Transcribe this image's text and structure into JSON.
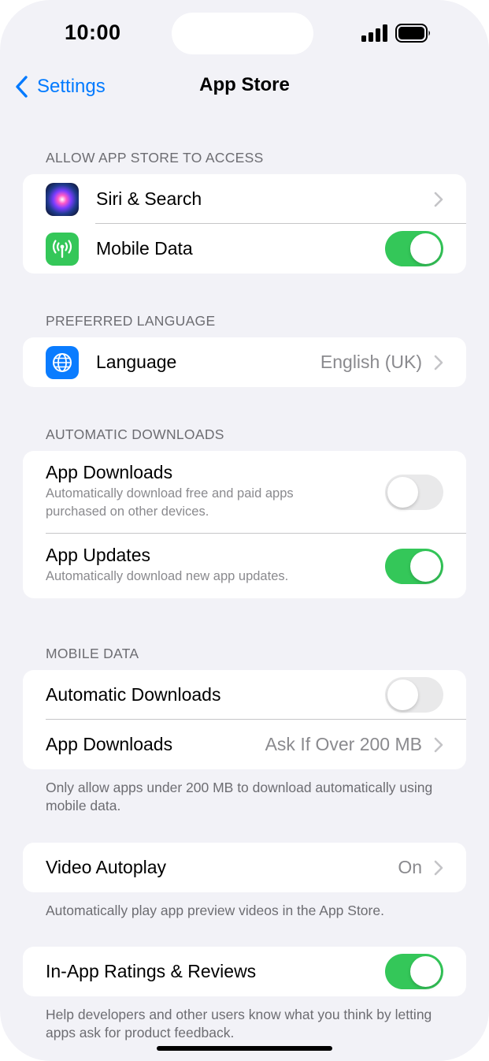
{
  "status_bar": {
    "time": "10:00"
  },
  "nav": {
    "back_label": "Settings",
    "title": "App Store"
  },
  "sections": {
    "access": {
      "header": "ALLOW APP STORE TO ACCESS",
      "siri": {
        "label": "Siri & Search",
        "icon": "siri-icon"
      },
      "mobile_data": {
        "label": "Mobile Data",
        "icon": "antenna-icon",
        "enabled": true
      }
    },
    "language": {
      "header": "PREFERRED LANGUAGE",
      "row": {
        "label": "Language",
        "value": "English (UK)",
        "icon": "globe-icon"
      }
    },
    "automatic_downloads": {
      "header": "AUTOMATIC DOWNLOADS",
      "app_downloads": {
        "label": "App Downloads",
        "description": "Automatically download free and paid apps purchased on other devices.",
        "enabled": false
      },
      "app_updates": {
        "label": "App Updates",
        "description": "Automatically download new app updates.",
        "enabled": true
      }
    },
    "mobile_data": {
      "header": "MOBILE DATA",
      "automatic_downloads": {
        "label": "Automatic Downloads",
        "enabled": false
      },
      "app_downloads": {
        "label": "App Downloads",
        "value": "Ask If Over 200 MB"
      },
      "footer": "Only allow apps under 200 MB to download automatically using mobile data."
    },
    "video": {
      "row": {
        "label": "Video Autoplay",
        "value": "On"
      },
      "footer": "Automatically play app preview videos in the App Store."
    },
    "ratings": {
      "row": {
        "label": "In-App Ratings & Reviews",
        "enabled": true
      },
      "footer": "Help developers and other users know what you think by letting apps ask for product feedback."
    }
  },
  "colors": {
    "accent": "#007aff",
    "toggle_on": "#34c759",
    "toggle_off": "#e9e9ea",
    "background": "#f2f2f7"
  }
}
